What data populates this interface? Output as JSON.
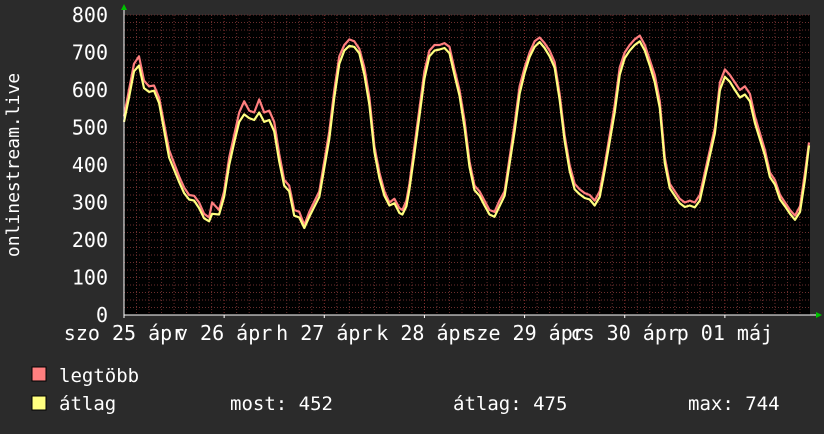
{
  "chart_data": {
    "type": "line",
    "ylabel": "onlinestream.live",
    "ylim": [
      0,
      800
    ],
    "yticks": [
      0,
      100,
      200,
      300,
      400,
      500,
      600,
      700,
      800
    ],
    "grid": true,
    "x_range": [
      0,
      6.85
    ],
    "x_ticks": [
      {
        "x": 0,
        "label": "szo 25 ápr"
      },
      {
        "x": 1,
        "label": "v 26 ápr"
      },
      {
        "x": 2,
        "label": "h 27 ápr"
      },
      {
        "x": 3,
        "label": "k 28 ápr"
      },
      {
        "x": 4,
        "label": "sze 29 ápr"
      },
      {
        "x": 5,
        "label": "cs 30 ápr"
      },
      {
        "x": 6,
        "label": "p 01 máj"
      }
    ],
    "series": [
      {
        "name": "legtöbb",
        "color": "#ff7f7f",
        "points": [
          [
            0.0,
            530
          ],
          [
            0.05,
            600
          ],
          [
            0.1,
            670
          ],
          [
            0.15,
            690
          ],
          [
            0.2,
            625
          ],
          [
            0.25,
            610
          ],
          [
            0.3,
            612
          ],
          [
            0.35,
            580
          ],
          [
            0.45,
            440
          ],
          [
            0.55,
            370
          ],
          [
            0.6,
            340
          ],
          [
            0.65,
            320
          ],
          [
            0.7,
            318
          ],
          [
            0.75,
            300
          ],
          [
            0.8,
            270
          ],
          [
            0.85,
            260
          ],
          [
            0.88,
            300
          ],
          [
            0.95,
            280
          ],
          [
            1.0,
            330
          ],
          [
            1.05,
            420
          ],
          [
            1.1,
            480
          ],
          [
            1.15,
            540
          ],
          [
            1.2,
            570
          ],
          [
            1.25,
            545
          ],
          [
            1.3,
            540
          ],
          [
            1.35,
            575
          ],
          [
            1.4,
            540
          ],
          [
            1.45,
            545
          ],
          [
            1.5,
            515
          ],
          [
            1.55,
            430
          ],
          [
            1.6,
            360
          ],
          [
            1.65,
            345
          ],
          [
            1.7,
            280
          ],
          [
            1.75,
            275
          ],
          [
            1.8,
            240
          ],
          [
            1.85,
            275
          ],
          [
            1.95,
            330
          ],
          [
            2.05,
            490
          ],
          [
            2.1,
            600
          ],
          [
            2.15,
            690
          ],
          [
            2.2,
            720
          ],
          [
            2.25,
            735
          ],
          [
            2.3,
            730
          ],
          [
            2.35,
            710
          ],
          [
            2.4,
            660
          ],
          [
            2.45,
            580
          ],
          [
            2.5,
            450
          ],
          [
            2.55,
            380
          ],
          [
            2.6,
            330
          ],
          [
            2.65,
            300
          ],
          [
            2.7,
            310
          ],
          [
            2.75,
            285
          ],
          [
            2.78,
            280
          ],
          [
            2.82,
            305
          ],
          [
            2.85,
            350
          ],
          [
            2.9,
            450
          ],
          [
            2.95,
            550
          ],
          [
            3.0,
            650
          ],
          [
            3.05,
            705
          ],
          [
            3.1,
            720
          ],
          [
            3.15,
            720
          ],
          [
            3.2,
            725
          ],
          [
            3.25,
            715
          ],
          [
            3.3,
            655
          ],
          [
            3.35,
            600
          ],
          [
            3.4,
            520
          ],
          [
            3.45,
            410
          ],
          [
            3.5,
            345
          ],
          [
            3.55,
            330
          ],
          [
            3.6,
            305
          ],
          [
            3.65,
            280
          ],
          [
            3.7,
            275
          ],
          [
            3.75,
            305
          ],
          [
            3.8,
            330
          ],
          [
            3.9,
            510
          ],
          [
            3.95,
            610
          ],
          [
            4.0,
            660
          ],
          [
            4.05,
            700
          ],
          [
            4.1,
            730
          ],
          [
            4.15,
            740
          ],
          [
            4.2,
            725
          ],
          [
            4.25,
            705
          ],
          [
            4.3,
            675
          ],
          [
            4.35,
            590
          ],
          [
            4.4,
            480
          ],
          [
            4.45,
            400
          ],
          [
            4.5,
            350
          ],
          [
            4.55,
            335
          ],
          [
            4.6,
            325
          ],
          [
            4.65,
            320
          ],
          [
            4.7,
            305
          ],
          [
            4.75,
            330
          ],
          [
            4.8,
            400
          ],
          [
            4.9,
            560
          ],
          [
            4.95,
            660
          ],
          [
            5.0,
            700
          ],
          [
            5.05,
            720
          ],
          [
            5.1,
            735
          ],
          [
            5.15,
            745
          ],
          [
            5.2,
            720
          ],
          [
            5.25,
            680
          ],
          [
            5.3,
            640
          ],
          [
            5.35,
            570
          ],
          [
            5.4,
            420
          ],
          [
            5.45,
            350
          ],
          [
            5.5,
            330
          ],
          [
            5.55,
            310
          ],
          [
            5.6,
            300
          ],
          [
            5.65,
            305
          ],
          [
            5.7,
            300
          ],
          [
            5.75,
            320
          ],
          [
            5.8,
            380
          ],
          [
            5.9,
            500
          ],
          [
            5.95,
            620
          ],
          [
            6.0,
            655
          ],
          [
            6.05,
            640
          ],
          [
            6.1,
            620
          ],
          [
            6.15,
            600
          ],
          [
            6.2,
            610
          ],
          [
            6.25,
            590
          ],
          [
            6.3,
            530
          ],
          [
            6.4,
            440
          ],
          [
            6.45,
            380
          ],
          [
            6.5,
            360
          ],
          [
            6.55,
            320
          ],
          [
            6.6,
            300
          ],
          [
            6.65,
            280
          ],
          [
            6.7,
            265
          ],
          [
            6.75,
            290
          ],
          [
            6.8,
            380
          ],
          [
            6.84,
            460
          ]
        ]
      },
      {
        "name": "átlag",
        "color": "#ffff80",
        "points": [
          [
            0.0,
            515
          ],
          [
            0.05,
            580
          ],
          [
            0.1,
            650
          ],
          [
            0.15,
            665
          ],
          [
            0.2,
            605
          ],
          [
            0.25,
            595
          ],
          [
            0.3,
            598
          ],
          [
            0.35,
            565
          ],
          [
            0.45,
            420
          ],
          [
            0.55,
            355
          ],
          [
            0.6,
            325
          ],
          [
            0.65,
            308
          ],
          [
            0.7,
            305
          ],
          [
            0.75,
            285
          ],
          [
            0.8,
            258
          ],
          [
            0.85,
            250
          ],
          [
            0.88,
            270
          ],
          [
            0.95,
            268
          ],
          [
            1.0,
            315
          ],
          [
            1.05,
            400
          ],
          [
            1.1,
            460
          ],
          [
            1.15,
            515
          ],
          [
            1.2,
            535
          ],
          [
            1.25,
            525
          ],
          [
            1.3,
            520
          ],
          [
            1.35,
            540
          ],
          [
            1.4,
            515
          ],
          [
            1.45,
            520
          ],
          [
            1.5,
            490
          ],
          [
            1.55,
            410
          ],
          [
            1.6,
            345
          ],
          [
            1.65,
            330
          ],
          [
            1.7,
            265
          ],
          [
            1.75,
            260
          ],
          [
            1.8,
            232
          ],
          [
            1.85,
            262
          ],
          [
            1.95,
            315
          ],
          [
            2.05,
            470
          ],
          [
            2.1,
            580
          ],
          [
            2.15,
            670
          ],
          [
            2.2,
            705
          ],
          [
            2.25,
            718
          ],
          [
            2.3,
            715
          ],
          [
            2.35,
            698
          ],
          [
            2.4,
            640
          ],
          [
            2.45,
            560
          ],
          [
            2.5,
            435
          ],
          [
            2.55,
            365
          ],
          [
            2.6,
            318
          ],
          [
            2.65,
            292
          ],
          [
            2.7,
            298
          ],
          [
            2.75,
            272
          ],
          [
            2.78,
            268
          ],
          [
            2.82,
            290
          ],
          [
            2.85,
            335
          ],
          [
            2.9,
            430
          ],
          [
            2.95,
            530
          ],
          [
            3.0,
            630
          ],
          [
            3.05,
            690
          ],
          [
            3.1,
            705
          ],
          [
            3.15,
            708
          ],
          [
            3.2,
            712
          ],
          [
            3.25,
            698
          ],
          [
            3.3,
            640
          ],
          [
            3.35,
            585
          ],
          [
            3.4,
            500
          ],
          [
            3.45,
            395
          ],
          [
            3.5,
            333
          ],
          [
            3.55,
            318
          ],
          [
            3.6,
            292
          ],
          [
            3.65,
            268
          ],
          [
            3.7,
            262
          ],
          [
            3.75,
            290
          ],
          [
            3.8,
            318
          ],
          [
            3.9,
            490
          ],
          [
            3.95,
            590
          ],
          [
            4.0,
            645
          ],
          [
            4.05,
            688
          ],
          [
            4.1,
            715
          ],
          [
            4.15,
            728
          ],
          [
            4.2,
            712
          ],
          [
            4.25,
            690
          ],
          [
            4.3,
            660
          ],
          [
            4.35,
            575
          ],
          [
            4.4,
            465
          ],
          [
            4.45,
            385
          ],
          [
            4.5,
            335
          ],
          [
            4.55,
            322
          ],
          [
            4.6,
            312
          ],
          [
            4.65,
            308
          ],
          [
            4.7,
            292
          ],
          [
            4.75,
            315
          ],
          [
            4.8,
            385
          ],
          [
            4.9,
            540
          ],
          [
            4.95,
            640
          ],
          [
            5.0,
            685
          ],
          [
            5.05,
            705
          ],
          [
            5.1,
            720
          ],
          [
            5.15,
            730
          ],
          [
            5.2,
            705
          ],
          [
            5.25,
            665
          ],
          [
            5.3,
            620
          ],
          [
            5.35,
            552
          ],
          [
            5.4,
            405
          ],
          [
            5.45,
            338
          ],
          [
            5.5,
            318
          ],
          [
            5.55,
            298
          ],
          [
            5.6,
            288
          ],
          [
            5.65,
            292
          ],
          [
            5.7,
            287
          ],
          [
            5.75,
            305
          ],
          [
            5.8,
            365
          ],
          [
            5.9,
            485
          ],
          [
            5.95,
            600
          ],
          [
            6.0,
            635
          ],
          [
            6.05,
            622
          ],
          [
            6.1,
            600
          ],
          [
            6.15,
            580
          ],
          [
            6.2,
            588
          ],
          [
            6.25,
            570
          ],
          [
            6.3,
            512
          ],
          [
            6.4,
            425
          ],
          [
            6.45,
            368
          ],
          [
            6.5,
            348
          ],
          [
            6.55,
            308
          ],
          [
            6.6,
            290
          ],
          [
            6.65,
            270
          ],
          [
            6.7,
            254
          ],
          [
            6.75,
            275
          ],
          [
            6.8,
            362
          ],
          [
            6.84,
            452
          ]
        ]
      }
    ]
  },
  "legend": [
    {
      "label": "legtöbb",
      "color": "#ff7f7f"
    },
    {
      "label": "átlag",
      "color": "#ffff80"
    }
  ],
  "stats": {
    "most": "most: 452",
    "atlag": "átlag: 475",
    "max": "max: 744"
  },
  "colors": {
    "background": "#2b2b2b",
    "plot_background": "#000000",
    "grid": "#6b2e2e",
    "axis_arrow": "#00c000",
    "text": "#ffffff"
  }
}
